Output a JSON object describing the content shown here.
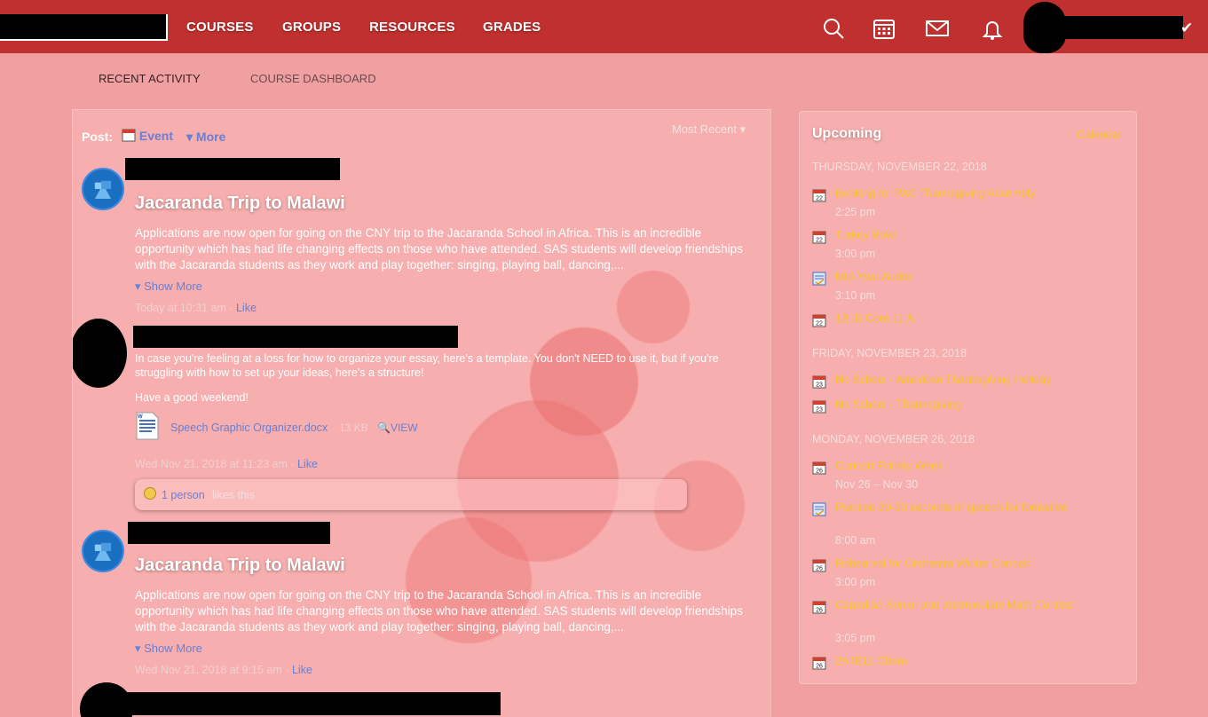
{
  "nav": {
    "links": [
      "COURSES",
      "GROUPS",
      "RESOURCES",
      "GRADES"
    ]
  },
  "subtabs": [
    "RECENT ACTIVITY",
    "COURSE DASHBOARD"
  ],
  "feed": {
    "post_label": "Post:",
    "post_event": "Event",
    "post_more": "More",
    "sort": "Most Recent",
    "posts": [
      {
        "title": "Jacaranda Trip to Malawi",
        "body": "Applications are now open for going on the CNY trip to the Jacaranda School in Africa. This is an incredible opportunity which has had life changing effects on those who have attended. SAS students will develop friendships with the Jacaranda students as they work and play together: singing, playing ball, dancing,...",
        "show_more": "Show More",
        "time": "Today at 10:31 am",
        "like": "Like"
      },
      {
        "body1": "In case you're feeling at a loss for how to organize your essay, here's a template. You don't NEED to use it, but if you're struggling with how to set up your ideas, here's a structure!",
        "body2": "Have a good weekend!",
        "attachment": "Speech Graphic Organizer.docx",
        "size": "13 KB",
        "view": "VIEW",
        "time": "Wed Nov 21, 2018 at 11:23 am",
        "like": "Like",
        "likes_count": "1 person",
        "likes_rest": "likes this"
      },
      {
        "title": "Jacaranda Trip to Malawi",
        "body": "Applications are now open for going on the CNY trip to the Jacaranda School in Africa. This is an incredible opportunity which has had life changing effects on those who have attended. SAS students will develop friendships with the Jacaranda students as they work and play together: singing, playing ball, dancing,...",
        "show_more": "Show More",
        "time": "Wed Nov 21, 2018 at 9:15 am",
        "like": "Like"
      }
    ]
  },
  "upcoming": {
    "title": "Upcoming",
    "calendar_link": "Calendar",
    "days": [
      {
        "heading": "THURSDAY, NOVEMBER 22, 2018",
        "events": [
          {
            "title": "Booking for PAC Thanksgiving Assembly",
            "time": "2:25 pm",
            "icon": "calendar-icon",
            "day": "22"
          },
          {
            "title": "Turkey Bowl",
            "time": "3:00 pm",
            "icon": "calendar-icon",
            "day": "22"
          },
          {
            "title": "Mid-Year Audits",
            "time": "3:10 pm",
            "icon": "assignment-icon",
            "day": ""
          },
          {
            "title": "1B IB Core 11 A",
            "time": "",
            "icon": "calendar-icon",
            "day": "22"
          }
        ]
      },
      {
        "heading": "FRIDAY, NOVEMBER 23, 2018",
        "events": [
          {
            "title": "No School - American Thanksgiving Holiday",
            "time": "",
            "icon": "calendar-icon",
            "day": "23"
          },
          {
            "title": "No School - Thanksgiving",
            "time": "",
            "icon": "calendar-icon",
            "day": "23"
          }
        ]
      },
      {
        "heading": "MONDAY, NOVEMBER 26, 2018",
        "events": [
          {
            "title": "Concert Priority Week",
            "time": "Nov 26 – Nov 30",
            "icon": "calendar-icon",
            "day": "26"
          },
          {
            "title": "Practice 20-30 seconds of speech for formative",
            "time": "8:00 am",
            "icon": "assignment-icon",
            "day": ""
          },
          {
            "title": "Rehearsal for Orchestra Winter Concert",
            "time": "3:00 pm",
            "icon": "calendar-icon",
            "day": "26"
          },
          {
            "title": "Canadian Senior and Intermediate Math Contest",
            "time": "3:05 pm",
            "icon": "calendar-icon",
            "day": "26"
          },
          {
            "title": "2A IB12 Chem",
            "time": "",
            "icon": "calendar-icon",
            "day": "26"
          }
        ]
      }
    ]
  }
}
